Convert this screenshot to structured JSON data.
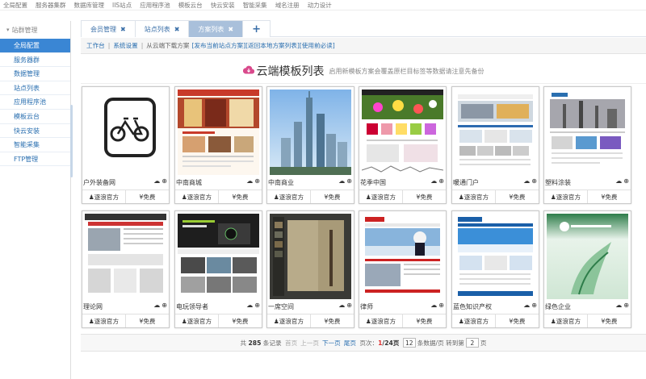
{
  "topnav": [
    "全局配置",
    "服务器集群",
    "数据库管理",
    "IIS站点",
    "应用程序池",
    "模板云台",
    "快云安装",
    "智能采集",
    "域名注册",
    "动力设计"
  ],
  "sidebar": {
    "header": "站群管理",
    "items": [
      "全局配置",
      "服务器群",
      "数据管理",
      "站点列表",
      "应用程序池",
      "模板云台",
      "快云安装",
      "智能采集",
      "FTP管理"
    ]
  },
  "tabs": [
    "会员管理",
    "站点列表",
    "方案列表"
  ],
  "tab_add": "+",
  "tab_close": "✖",
  "breadcrumb": {
    "home": "工作台",
    "settings": "系统设置",
    "text": "从云端下载方案",
    "link1": "[发布当前站点方案]",
    "link2": "[返回本地方案列表]",
    "link3": "[使用前必读]"
  },
  "heading": {
    "title": "云端模板列表",
    "subtitle": "启用新模板方案会覆盖原栏目标签等数据请注意先备份"
  },
  "cards": [
    {
      "name": "户外装备网",
      "author": "♟逐浪官方",
      "price": "¥免费",
      "thumb": "bike"
    },
    {
      "name": "中南商城",
      "author": "♟逐浪官方",
      "price": "¥免费",
      "thumb": "curtain"
    },
    {
      "name": "中南商业",
      "author": "♟逐浪官方",
      "price": "¥免费",
      "thumb": "city"
    },
    {
      "name": "花季中国",
      "author": "♟逐浪官方",
      "price": "¥免费",
      "thumb": "flower"
    },
    {
      "name": "暖通门户",
      "author": "♟逐浪官方",
      "price": "¥免费",
      "thumb": "portal"
    },
    {
      "name": "塑料涂装",
      "author": "♟逐浪官方",
      "price": "¥免费",
      "thumb": "factory"
    },
    {
      "name": "理论网",
      "author": "♟逐浪官方",
      "price": "¥免费",
      "thumb": "theory"
    },
    {
      "name": "电玩领导者",
      "author": "♟逐浪官方",
      "price": "¥免费",
      "thumb": "xbox"
    },
    {
      "name": "一席空间",
      "author": "♟逐浪官方",
      "price": "¥免费",
      "thumb": "space"
    },
    {
      "name": "律师",
      "author": "♟逐浪官方",
      "price": "¥免费",
      "thumb": "lawyer"
    },
    {
      "name": "蓝色知识产权",
      "author": "♟逐浪官方",
      "price": "¥免费",
      "thumb": "blue"
    },
    {
      "name": "绿色企业",
      "author": "♟逐浪官方",
      "price": "¥免费",
      "thumb": "green"
    }
  ],
  "pager": {
    "total_pre": "共",
    "total": "285",
    "total_post": "条记录",
    "first": "首页",
    "prev": "上一页",
    "next": "下一页",
    "last": "尾页",
    "page_label": "页次：",
    "page_cur": "1",
    "page_total": "/24页",
    "per_page": "12",
    "per_page_suffix": "条数据/页",
    "goto_pre": "转到第",
    "goto_val": "2",
    "goto_post": "页"
  },
  "colors": {
    "accent": "#3a86d4",
    "active_tab": "#a9c0db",
    "link": "#2a6fb0",
    "cloud": "#d94a8c"
  }
}
